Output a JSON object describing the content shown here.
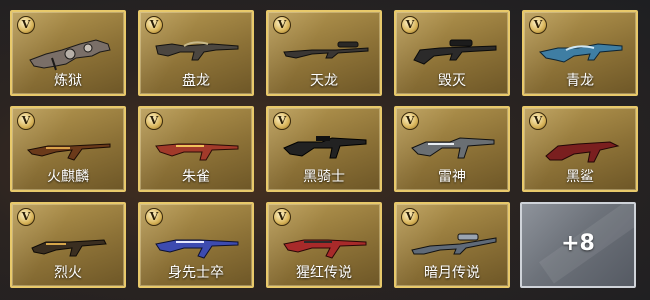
{
  "badge_letter": "V",
  "weapons": [
    {
      "name": "炼狱",
      "icon": "chain-gun-icon",
      "accent": "#7a6f68"
    },
    {
      "name": "盘龙",
      "icon": "rifle-icon",
      "accent": "#4b4640"
    },
    {
      "name": "天龙",
      "icon": "sniper-rifle-icon",
      "accent": "#3a3633"
    },
    {
      "name": "毁灭",
      "icon": "heavy-sniper-icon",
      "accent": "#2b2a2a"
    },
    {
      "name": "青龙",
      "icon": "assault-rifle-icon",
      "accent": "#3f7ea3"
    },
    {
      "name": "火麒麟",
      "icon": "ak-rifle-icon",
      "accent": "#6b3a1a"
    },
    {
      "name": "朱雀",
      "icon": "rifle-icon",
      "accent": "#a23a2a"
    },
    {
      "name": "黑骑士",
      "icon": "m4-rifle-icon",
      "accent": "#222222"
    },
    {
      "name": "雷神",
      "icon": "m4-rifle-icon",
      "accent": "#6a6f73"
    },
    {
      "name": "黑鲨",
      "icon": "smg-icon",
      "accent": "#7a1f1f"
    },
    {
      "name": "烈火",
      "icon": "smg-icon",
      "accent": "#3a2e20"
    },
    {
      "name": "身先士卒",
      "icon": "ak-rifle-icon",
      "accent": "#3d4bb0"
    },
    {
      "name": "猩红传说",
      "icon": "ak-rifle-icon",
      "accent": "#a82a2a"
    },
    {
      "name": "暗月传说",
      "icon": "sniper-rifle-icon",
      "accent": "#5f6a78"
    }
  ],
  "more": {
    "label": "+8"
  }
}
